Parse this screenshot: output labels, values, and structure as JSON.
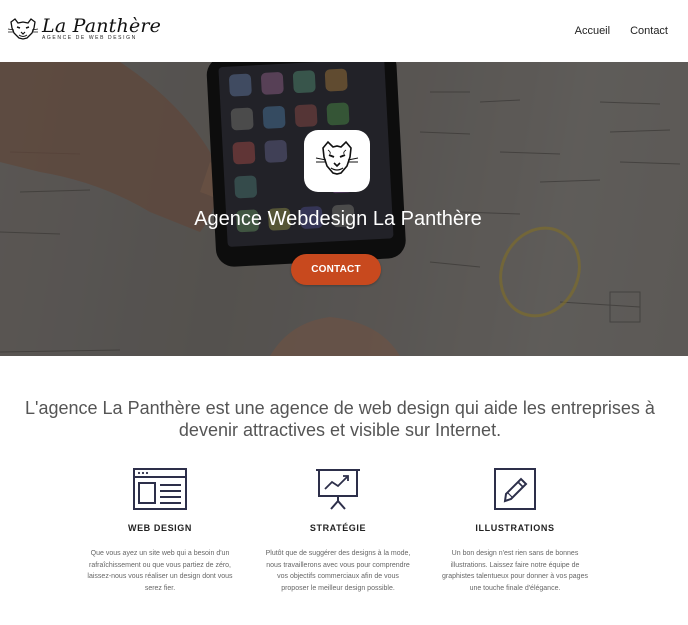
{
  "brand": {
    "name": "La Panthère",
    "tagline": "Agence de web design"
  },
  "nav": {
    "items": [
      {
        "label": "Accueil"
      },
      {
        "label": "Contact"
      }
    ]
  },
  "hero": {
    "title": "Agence Webdesign La Panthère",
    "cta_label": "CONTACT",
    "cta_color": "#c8491e"
  },
  "intro": {
    "text": "L'agence La Panthère est une agence de web design qui aide les entreprises à devenir attractives et visible sur Internet."
  },
  "services": [
    {
      "icon": "browser-window-icon",
      "title": "WEB DESIGN",
      "text": "Que vous ayez un site web qui a besoin d'un rafraîchissement ou que vous partiez de zéro, laissez-nous vous réaliser un design dont vous serez fier."
    },
    {
      "icon": "presentation-chart-icon",
      "title": "STRATÉGIE",
      "text": "Plutôt que de suggérer des designs à la mode, nous travaillerons avec vous pour comprendre vos objectifs commerciaux afin de vous proposer le meilleur design possible."
    },
    {
      "icon": "pencil-icon",
      "title": "ILLUSTRATIONS",
      "text": "Un bon design n'est rien sans de bonnes illustrations. Laissez faire notre équipe de graphistes talentueux pour donner à vos pages une touche finale d'élégance."
    }
  ]
}
